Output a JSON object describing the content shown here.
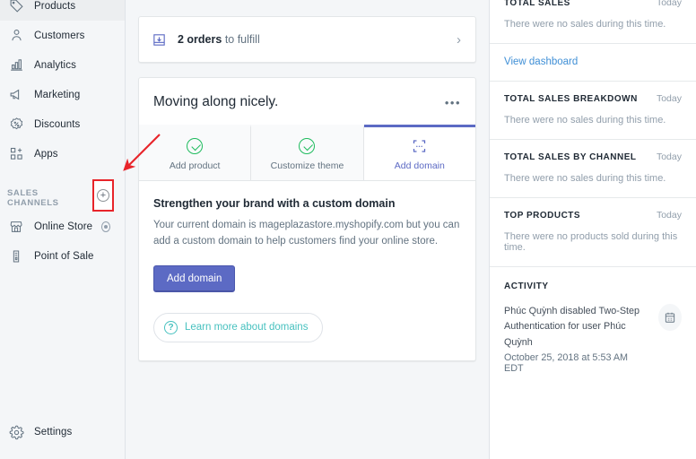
{
  "sidebar": {
    "nav_items": [
      {
        "label": "Products",
        "icon": "tag-icon"
      },
      {
        "label": "Customers",
        "icon": "person-icon"
      },
      {
        "label": "Analytics",
        "icon": "bar-chart-icon"
      },
      {
        "label": "Marketing",
        "icon": "megaphone-icon"
      },
      {
        "label": "Discounts",
        "icon": "percent-badge-icon"
      },
      {
        "label": "Apps",
        "icon": "apps-grid-plus-icon"
      }
    ],
    "sales_channels": {
      "section_label": "SALES CHANNELS",
      "add_button_label": "+",
      "add_button_name": "add-sales-channel-button",
      "items": [
        {
          "label": "Online Store",
          "icon": "storefront-icon",
          "has_settings": true
        },
        {
          "label": "Point of Sale",
          "icon": "pos-device-icon",
          "has_settings": false
        }
      ]
    },
    "settings": {
      "label": "Settings",
      "icon": "gear-icon"
    }
  },
  "annotation": {
    "highlight_color": "#e8242a",
    "arrow_color": "#e8242a",
    "target": "add-sales-channel-button"
  },
  "main": {
    "banner": {
      "count_text": "2 orders",
      "rest_text": " to fulfill",
      "icon": "fulfillment-inbox-icon",
      "chevron": "›"
    },
    "onboarding": {
      "title": "Moving along nicely.",
      "more_menu": "•••",
      "tabs": [
        {
          "label": "Add product",
          "state": "complete",
          "icon": "check-circle-icon"
        },
        {
          "label": "Customize theme",
          "state": "complete",
          "icon": "check-circle-icon"
        },
        {
          "label": "Add domain",
          "state": "active",
          "icon": "domain-dotted-icon"
        }
      ],
      "panel": {
        "heading": "Strengthen your brand with a custom domain",
        "body": "Your current domain is mageplazastore.myshopify.com but you can add a custom domain to help customers find your online store.",
        "primary_button": "Add domain",
        "learn_more": "Learn more about domains",
        "learn_more_icon": "question-circle-icon"
      }
    }
  },
  "right_panel": {
    "sections": [
      {
        "title": "TOTAL SALES",
        "when": "Today",
        "empty": "There were no sales during this time."
      },
      {
        "title": "TOTAL SALES BREAKDOWN",
        "when": "Today",
        "empty": "There were no sales during this time."
      },
      {
        "title": "TOTAL SALES BY CHANNEL",
        "when": "Today",
        "empty": "There were no sales during this time."
      },
      {
        "title": "TOP PRODUCTS",
        "when": "Today",
        "empty": "There were no products sold during this time."
      }
    ],
    "view_dashboard_link": "View dashboard",
    "activity": {
      "title": "ACTIVITY",
      "text": "Phúc Quỳnh disabled Two-Step Authentication for user Phúc Quỳnh",
      "date": "October 25, 2018 at 5:53 AM EDT",
      "icon": "calendar-note-icon"
    }
  },
  "colors": {
    "accent_purple": "#5c6ac4",
    "link_blue": "#3f8fd6",
    "teal": "#47c1bf",
    "success_green": "#1ebb5d",
    "highlight_red": "#e8242a"
  }
}
